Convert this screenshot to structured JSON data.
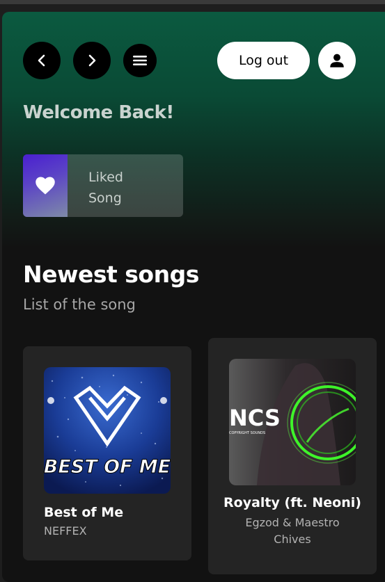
{
  "header": {
    "back_icon": "chevron-left-icon",
    "forward_icon": "chevron-right-icon",
    "menu_icon": "hamburger-menu-icon",
    "logout_label": "Log out",
    "user_icon": "user-icon"
  },
  "welcome": "Welcome Back!",
  "liked": {
    "line1": "Liked",
    "line2": "Song",
    "icon": "heart-icon"
  },
  "section": {
    "title": "Newest songs",
    "subtitle": "List of the song"
  },
  "songs": [
    {
      "title": "Best of Me",
      "artist": "NEFFEX",
      "cover_text": "BEST OF ME"
    },
    {
      "title": "Royalty (ft. Neoni)",
      "artist_line1": "Egzod & Maestro",
      "artist_line2": "Chives",
      "cover_text": "NCS",
      "cover_subtext": "COPYRIGHT SOUNDS"
    }
  ],
  "colors": {
    "gradient_top": "#0b5a40",
    "background": "#121212",
    "card": "#242424",
    "liked_purple": "#4a1fd0"
  }
}
